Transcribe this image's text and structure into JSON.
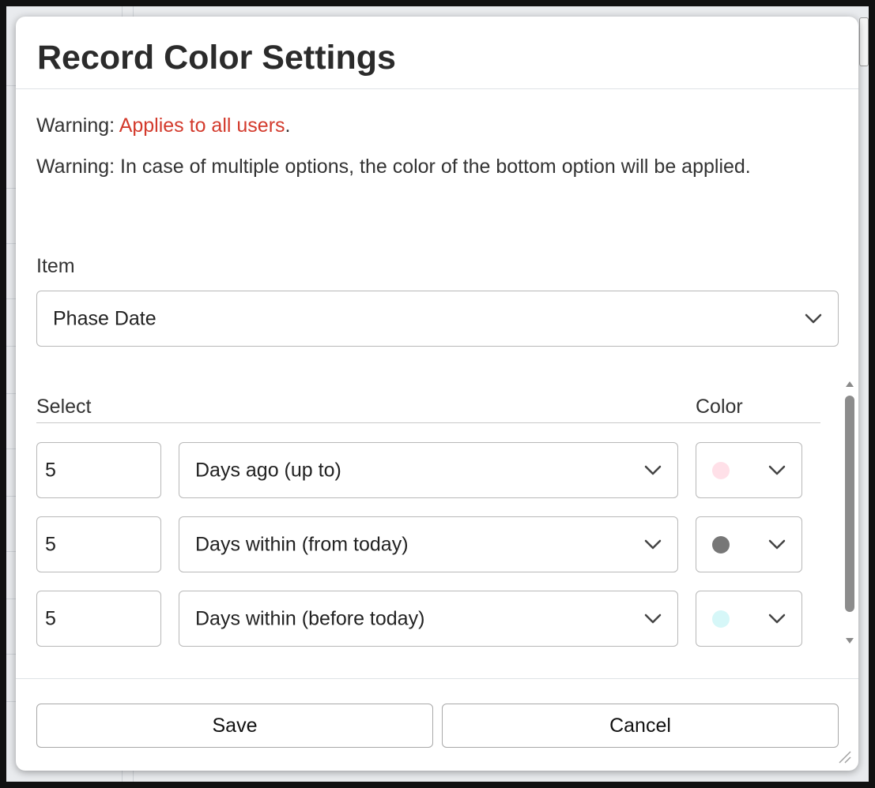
{
  "dialog": {
    "title": "Record Color Settings",
    "warning1_prefix": "Warning: ",
    "warning1_highlight": "Applies to all users",
    "warning1_suffix": ".",
    "warning2": "Warning: In case of multiple options, the color of the bottom option will be applied."
  },
  "item_field": {
    "label": "Item",
    "value": "Phase Date"
  },
  "conditions": {
    "select_header": "Select",
    "color_header": "Color",
    "rows": [
      {
        "number": "5",
        "condition": "Days ago (up to)",
        "color": "#ffe0e8"
      },
      {
        "number": "5",
        "condition": "Days within (from today)",
        "color": "#777777"
      },
      {
        "number": "5",
        "condition": "Days within (before today)",
        "color": "#d6f7f8"
      }
    ]
  },
  "footer": {
    "save_label": "Save",
    "cancel_label": "Cancel"
  },
  "icons": {
    "dropdown": "chevron-down-icon",
    "resize": "resize-grip-icon"
  }
}
